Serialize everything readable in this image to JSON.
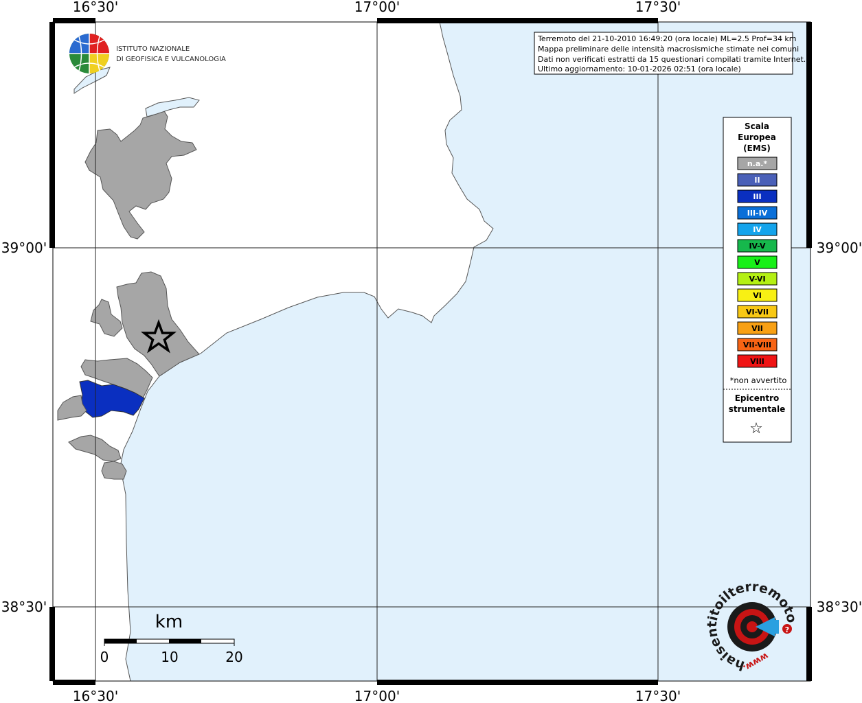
{
  "map": {
    "lon_labels": [
      "16°30'",
      "17°00'",
      "17°30'"
    ],
    "lat_labels": [
      "39°00'",
      "38°30'"
    ],
    "sea_color": "#e1f1fc",
    "land_color": "#ffffff",
    "reported_na_color": "#a6a6a6",
    "intensity_III_color": "#0a2fc0"
  },
  "info_box": {
    "line1": "Terremoto del 21-10-2010 16:49:20 (ora locale) ML=2.5 Prof=34 km",
    "line2": "Mappa preliminare delle intensità macrosismiche stimate nei comuni",
    "line3": "Dati non verificati estratti da 15 questionari compilati tramite Internet.",
    "line4": "Ultimo aggiornamento: 10-01-2026 02:51 (ora locale)"
  },
  "logo": {
    "line1": "ISTITUTO NAZIONALE",
    "line2": "DI GEOFISICA E VULCANOLOGIA"
  },
  "legend": {
    "title1": "Scala",
    "title2": "Europea",
    "title3": "(EMS)",
    "items": [
      {
        "label": "n.a.*",
        "color": "#a6a6a6",
        "text_color": "#ffffff"
      },
      {
        "label": "II",
        "color": "#4a60b8",
        "text_color": "#ffffff"
      },
      {
        "label": "III",
        "color": "#0a2fc0",
        "text_color": "#ffffff"
      },
      {
        "label": "III-IV",
        "color": "#0a6fd8",
        "text_color": "#ffffff"
      },
      {
        "label": "IV",
        "color": "#14a4ec",
        "text_color": "#ffffff"
      },
      {
        "label": "IV-V",
        "color": "#16b84c",
        "text_color": "#000000"
      },
      {
        "label": "V",
        "color": "#18f018",
        "text_color": "#000000"
      },
      {
        "label": "V-VI",
        "color": "#b4f014",
        "text_color": "#000000"
      },
      {
        "label": "VI",
        "color": "#f8f014",
        "text_color": "#000000"
      },
      {
        "label": "VI-VII",
        "color": "#f8c814",
        "text_color": "#000000"
      },
      {
        "label": "VII",
        "color": "#f8a014",
        "text_color": "#000000"
      },
      {
        "label": "VII-VIII",
        "color": "#f86414",
        "text_color": "#000000"
      },
      {
        "label": "VIII",
        "color": "#f01414",
        "text_color": "#000000"
      }
    ],
    "note": "*non avvertito",
    "epi1": "Epicentro",
    "epi2": "strumentale",
    "epi_symbol": "☆"
  },
  "scale_bar": {
    "unit": "km",
    "labels": [
      "0",
      "10",
      "20"
    ]
  },
  "haisentito": {
    "ring_text": "haisentitoilterremoto.it",
    "url_text": "www.",
    "question": "?"
  }
}
